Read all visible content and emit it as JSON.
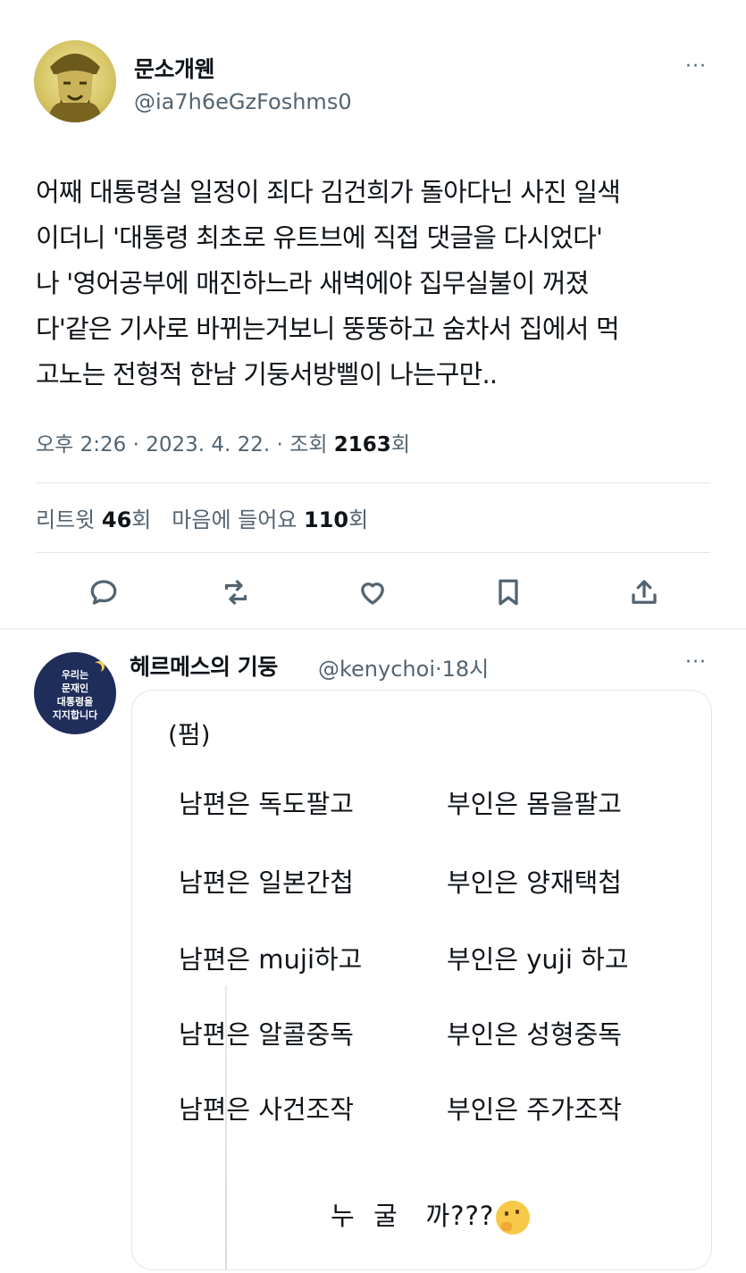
{
  "main_tweet": {
    "display_name": "문소개웬",
    "handle": "@ia7h6eGzFoshms0",
    "text_lines": [
      "어째 대통령실 일정이 죄다 김건희가 돌아다닌 사진 일색",
      "이더니 '대통령 최초로 유트브에 직접 댓글을 다시었다'",
      "나 '영어공부에 매진하느라 새벽에야 집무실불이 꺼졌",
      "다'같은 기사로 바뀌는거보니 뚱뚱하고 숨차서 집에서 먹",
      "고노는 전형적 한남 기둥서방삘이 나는구만.."
    ],
    "time": "오후 2:26",
    "date": "2023. 4. 22.",
    "views_label": "조회",
    "views_count": "2163",
    "views_suffix": "회",
    "retweets_label": "리트윗",
    "retweets_count": "46",
    "retweets_suffix": "회",
    "likes_label": "마음에 들어요",
    "likes_count": "110",
    "likes_suffix": "회",
    "more": "···"
  },
  "actions": {
    "icons": [
      "reply-icon",
      "retweet-icon",
      "like-icon",
      "bookmark-icon",
      "share-icon"
    ]
  },
  "reply_tweet": {
    "display_name": "헤르메스의 기둥",
    "handle": "@kenychoi",
    "time": "18시",
    "more": "···",
    "avatar_text": [
      "우리는",
      "문재인",
      "대통령을",
      "지지합니다"
    ],
    "card": {
      "header": "(펌)",
      "rows": [
        {
          "left": "남편은 독도팔고",
          "right": "부인은 몸을팔고"
        },
        {
          "left": "남편은 일본간첩",
          "right": "부인은 양재택첩"
        },
        {
          "left": "남편은 muji하고",
          "right": "부인은 yuji 하고"
        },
        {
          "left": "남편은 알콜중독",
          "right": "부인은 성형중독"
        },
        {
          "left": "남편은 사건조작",
          "right": "부인은 주가조작"
        }
      ],
      "punchline": "누  굴   까???",
      "emoji": "thinking-face-icon"
    }
  }
}
